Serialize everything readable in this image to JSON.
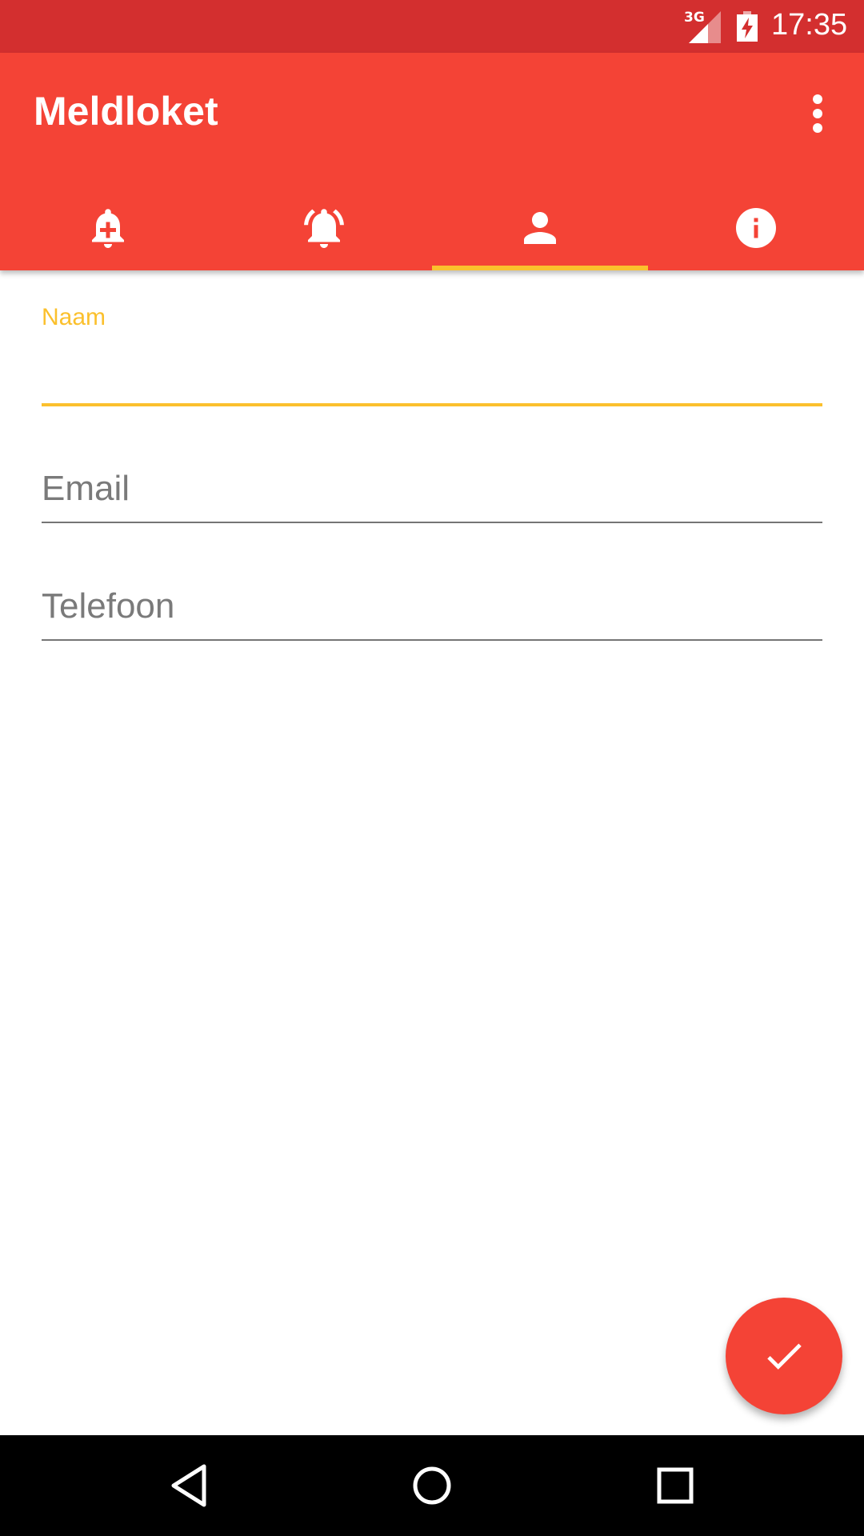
{
  "status_bar": {
    "network_label": "3G",
    "time": "17:35",
    "icons": [
      "signal-icon",
      "battery-charging-icon"
    ]
  },
  "app_bar": {
    "title": "Meldloket",
    "menu_icon": "overflow-menu-icon",
    "tabs": [
      {
        "icon": "bell-plus-icon",
        "active": false
      },
      {
        "icon": "bell-ringing-icon",
        "active": false
      },
      {
        "icon": "person-icon",
        "active": true
      },
      {
        "icon": "info-icon",
        "active": false
      }
    ]
  },
  "form": {
    "name": {
      "label": "Naam",
      "value": ""
    },
    "email": {
      "placeholder": "Email",
      "value": ""
    },
    "phone": {
      "placeholder": "Telefoon",
      "value": ""
    }
  },
  "fab": {
    "icon": "check-icon"
  },
  "nav_bar": {
    "buttons": [
      "back-icon",
      "home-icon",
      "recents-icon"
    ]
  },
  "colors": {
    "status_bar": "#d32f2f",
    "primary": "#f44336",
    "accent": "#fbc02d",
    "hint_text": "#7a7a7a"
  }
}
